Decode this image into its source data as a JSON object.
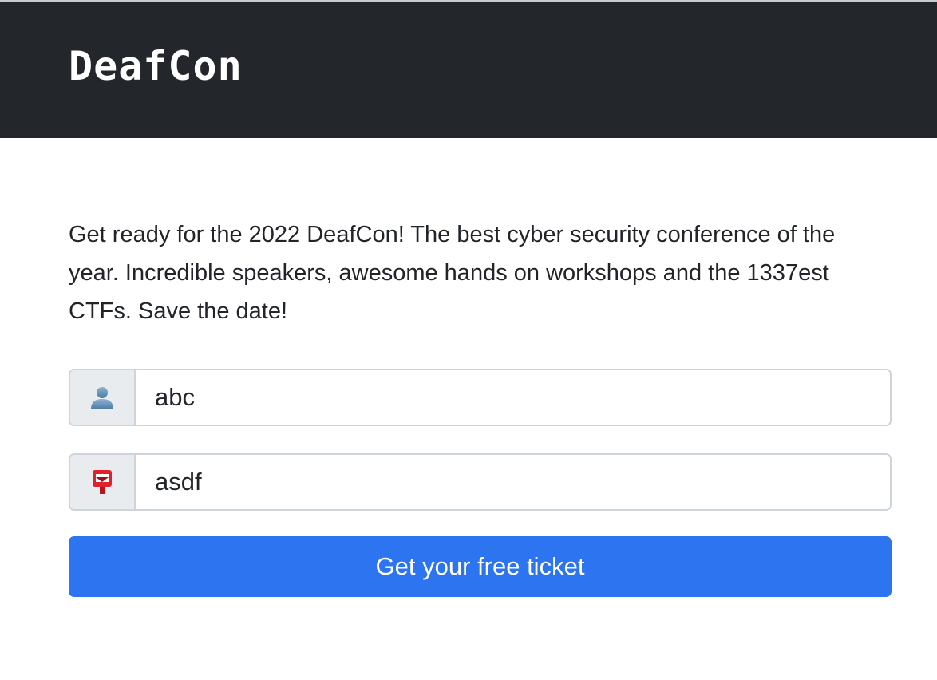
{
  "header": {
    "brand": "DeafCon"
  },
  "main": {
    "intro": "Get ready for the 2022 DeafCon! The best cyber security conference of the year. Incredible speakers, awesome hands on workshops and the 1337est CTFs. Save the date!",
    "name_field": {
      "icon": "person-silhouette-icon",
      "value": "abc"
    },
    "email_field": {
      "icon": "postbox-icon",
      "value": "asdf"
    },
    "submit_label": "Get your free ticket"
  },
  "colors": {
    "navbar": "#23272c",
    "button": "#2d74f0",
    "addon_bg": "#e9ecef",
    "border": "#ced4da"
  }
}
